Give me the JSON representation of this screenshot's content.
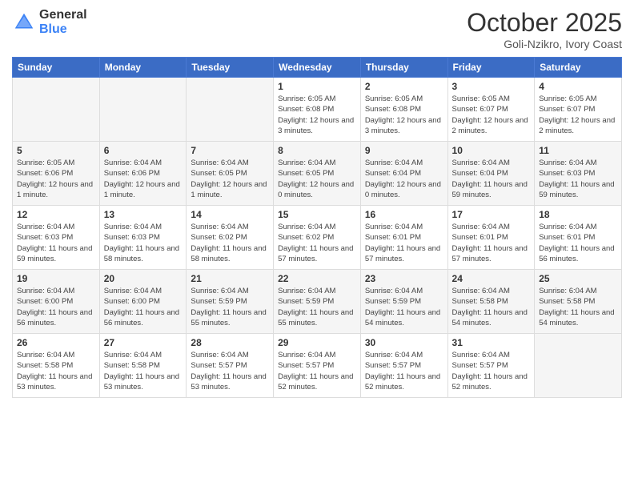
{
  "header": {
    "logo_general": "General",
    "logo_blue": "Blue",
    "month_title": "October 2025",
    "subtitle": "Goli-Nzikro, Ivory Coast"
  },
  "weekdays": [
    "Sunday",
    "Monday",
    "Tuesday",
    "Wednesday",
    "Thursday",
    "Friday",
    "Saturday"
  ],
  "weeks": [
    [
      {
        "day": "",
        "info": ""
      },
      {
        "day": "",
        "info": ""
      },
      {
        "day": "",
        "info": ""
      },
      {
        "day": "1",
        "info": "Sunrise: 6:05 AM\nSunset: 6:08 PM\nDaylight: 12 hours and 3 minutes."
      },
      {
        "day": "2",
        "info": "Sunrise: 6:05 AM\nSunset: 6:08 PM\nDaylight: 12 hours and 3 minutes."
      },
      {
        "day": "3",
        "info": "Sunrise: 6:05 AM\nSunset: 6:07 PM\nDaylight: 12 hours and 2 minutes."
      },
      {
        "day": "4",
        "info": "Sunrise: 6:05 AM\nSunset: 6:07 PM\nDaylight: 12 hours and 2 minutes."
      }
    ],
    [
      {
        "day": "5",
        "info": "Sunrise: 6:05 AM\nSunset: 6:06 PM\nDaylight: 12 hours and 1 minute."
      },
      {
        "day": "6",
        "info": "Sunrise: 6:04 AM\nSunset: 6:06 PM\nDaylight: 12 hours and 1 minute."
      },
      {
        "day": "7",
        "info": "Sunrise: 6:04 AM\nSunset: 6:05 PM\nDaylight: 12 hours and 1 minute."
      },
      {
        "day": "8",
        "info": "Sunrise: 6:04 AM\nSunset: 6:05 PM\nDaylight: 12 hours and 0 minutes."
      },
      {
        "day": "9",
        "info": "Sunrise: 6:04 AM\nSunset: 6:04 PM\nDaylight: 12 hours and 0 minutes."
      },
      {
        "day": "10",
        "info": "Sunrise: 6:04 AM\nSunset: 6:04 PM\nDaylight: 11 hours and 59 minutes."
      },
      {
        "day": "11",
        "info": "Sunrise: 6:04 AM\nSunset: 6:03 PM\nDaylight: 11 hours and 59 minutes."
      }
    ],
    [
      {
        "day": "12",
        "info": "Sunrise: 6:04 AM\nSunset: 6:03 PM\nDaylight: 11 hours and 59 minutes."
      },
      {
        "day": "13",
        "info": "Sunrise: 6:04 AM\nSunset: 6:03 PM\nDaylight: 11 hours and 58 minutes."
      },
      {
        "day": "14",
        "info": "Sunrise: 6:04 AM\nSunset: 6:02 PM\nDaylight: 11 hours and 58 minutes."
      },
      {
        "day": "15",
        "info": "Sunrise: 6:04 AM\nSunset: 6:02 PM\nDaylight: 11 hours and 57 minutes."
      },
      {
        "day": "16",
        "info": "Sunrise: 6:04 AM\nSunset: 6:01 PM\nDaylight: 11 hours and 57 minutes."
      },
      {
        "day": "17",
        "info": "Sunrise: 6:04 AM\nSunset: 6:01 PM\nDaylight: 11 hours and 57 minutes."
      },
      {
        "day": "18",
        "info": "Sunrise: 6:04 AM\nSunset: 6:01 PM\nDaylight: 11 hours and 56 minutes."
      }
    ],
    [
      {
        "day": "19",
        "info": "Sunrise: 6:04 AM\nSunset: 6:00 PM\nDaylight: 11 hours and 56 minutes."
      },
      {
        "day": "20",
        "info": "Sunrise: 6:04 AM\nSunset: 6:00 PM\nDaylight: 11 hours and 56 minutes."
      },
      {
        "day": "21",
        "info": "Sunrise: 6:04 AM\nSunset: 5:59 PM\nDaylight: 11 hours and 55 minutes."
      },
      {
        "day": "22",
        "info": "Sunrise: 6:04 AM\nSunset: 5:59 PM\nDaylight: 11 hours and 55 minutes."
      },
      {
        "day": "23",
        "info": "Sunrise: 6:04 AM\nSunset: 5:59 PM\nDaylight: 11 hours and 54 minutes."
      },
      {
        "day": "24",
        "info": "Sunrise: 6:04 AM\nSunset: 5:58 PM\nDaylight: 11 hours and 54 minutes."
      },
      {
        "day": "25",
        "info": "Sunrise: 6:04 AM\nSunset: 5:58 PM\nDaylight: 11 hours and 54 minutes."
      }
    ],
    [
      {
        "day": "26",
        "info": "Sunrise: 6:04 AM\nSunset: 5:58 PM\nDaylight: 11 hours and 53 minutes."
      },
      {
        "day": "27",
        "info": "Sunrise: 6:04 AM\nSunset: 5:58 PM\nDaylight: 11 hours and 53 minutes."
      },
      {
        "day": "28",
        "info": "Sunrise: 6:04 AM\nSunset: 5:57 PM\nDaylight: 11 hours and 53 minutes."
      },
      {
        "day": "29",
        "info": "Sunrise: 6:04 AM\nSunset: 5:57 PM\nDaylight: 11 hours and 52 minutes."
      },
      {
        "day": "30",
        "info": "Sunrise: 6:04 AM\nSunset: 5:57 PM\nDaylight: 11 hours and 52 minutes."
      },
      {
        "day": "31",
        "info": "Sunrise: 6:04 AM\nSunset: 5:57 PM\nDaylight: 11 hours and 52 minutes."
      },
      {
        "day": "",
        "info": ""
      }
    ]
  ]
}
